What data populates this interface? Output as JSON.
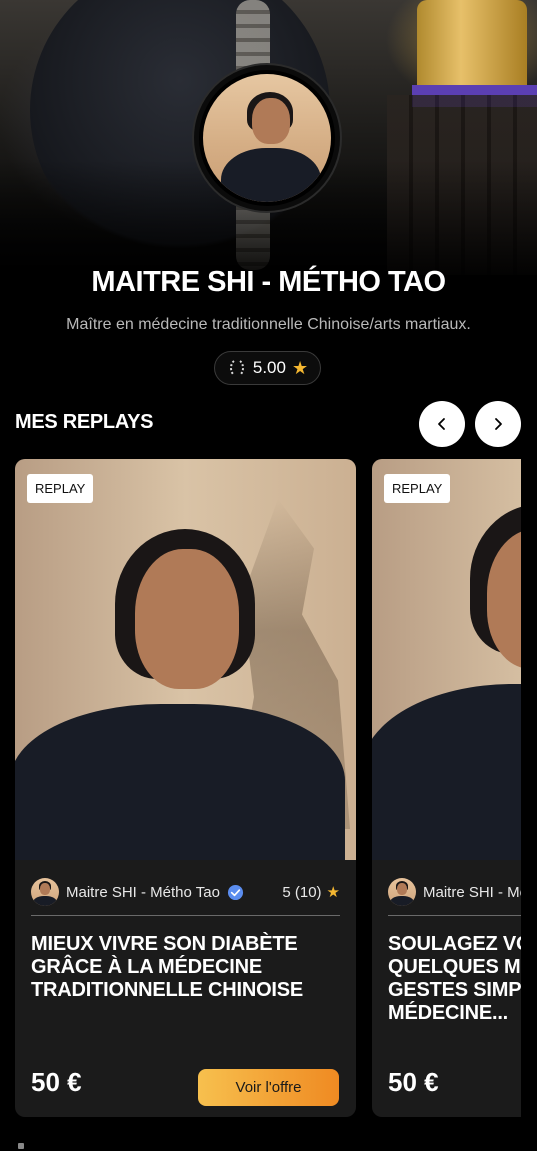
{
  "profile": {
    "name": "MAITRE SHI - MÉTHO TAO",
    "tagline": "Maître en médecine traditionnelle Chinoise/arts martiaux.",
    "rating": "5.00"
  },
  "section": {
    "title": "MES REPLAYS"
  },
  "icons": {
    "prev": "chevron-left-icon",
    "next": "chevron-right-icon",
    "star": "star-icon",
    "laurel": "laurel-icon",
    "verified": "verified-badge-icon"
  },
  "colors": {
    "accent_gradient_start": "#f7c04e",
    "accent_gradient_end": "#ef8a22",
    "star": "#f4b731",
    "verified": "#5b8def"
  },
  "cards": [
    {
      "badge": "REPLAY",
      "author": "Maitre SHI - Métho Tao",
      "rating": "5 (10)",
      "title": "MIEUX VIVRE SON DIABÈTE GRÂCE À LA MÉDECINE TRADITIONNELLE CHINOISE",
      "price": "50 €",
      "cta": "Voir l'offre"
    },
    {
      "badge": "REPLAY",
      "author": "Maitre SHI - Métho Tao",
      "title": "SOULAGEZ VOS DOULEURS EN QUELQUES MINUTES AVEC DES GESTES SIMPLES DE MÉDECINE...",
      "price": "50 €"
    }
  ]
}
